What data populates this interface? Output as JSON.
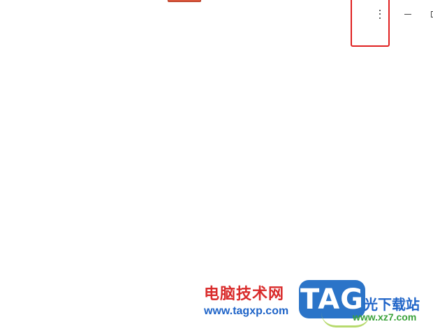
{
  "window_controls": {
    "more_icon": "vertical-ellipsis",
    "minimize_icon": "minimize",
    "maximize_icon": "maximize"
  },
  "watermark": {
    "brand_cn": "电脑技术网",
    "brand_url": "www.tagxp.com",
    "tag_text": "TAG",
    "site_cn": "光下载站",
    "site_url": "www.xz7.com"
  },
  "colors": {
    "highlight": "#e02020",
    "top_chip": "#d9553a",
    "brand_red": "#d92b2b",
    "brand_blue": "#2b74c8",
    "site_green": "#3aa23a"
  }
}
